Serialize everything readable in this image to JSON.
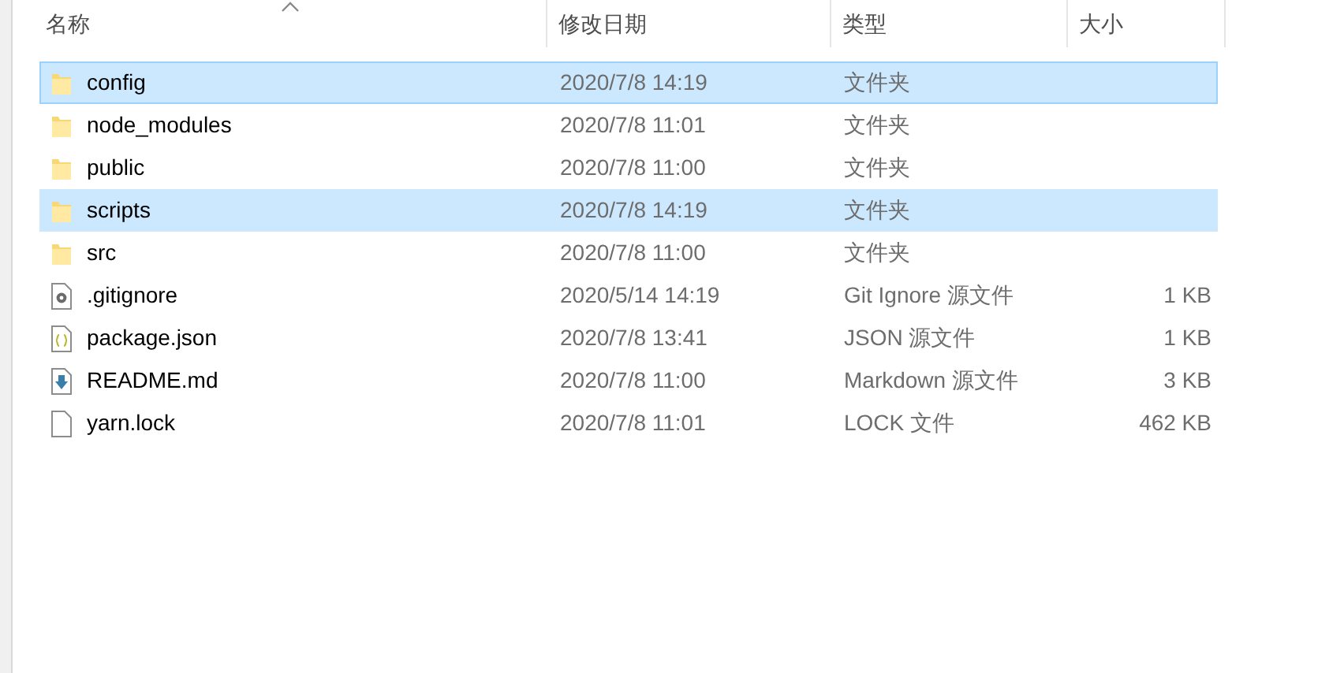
{
  "columns": [
    {
      "label": "名称",
      "sorted": true
    },
    {
      "label": "修改日期",
      "sorted": false
    },
    {
      "label": "类型",
      "sorted": false
    },
    {
      "label": "大小",
      "sorted": false
    }
  ],
  "rows": [
    {
      "name": "config",
      "kind": "folder",
      "date": "2020/7/8 14:19",
      "type": "文件夹",
      "selected": true,
      "focused": true
    },
    {
      "name": "node_modules",
      "kind": "folder",
      "date": "2020/7/8 11:01",
      "type": "文件夹",
      "selected": false,
      "focused": false
    },
    {
      "name": "public",
      "kind": "folder",
      "date": "2020/7/8 11:00",
      "type": "文件夹",
      "selected": false,
      "focused": false
    },
    {
      "name": "scripts",
      "kind": "folder",
      "date": "2020/7/8 14:19",
      "type": "文件夹",
      "selected": true,
      "focused": false
    },
    {
      "name": "src",
      "kind": "folder",
      "date": "2020/7/8 11:00",
      "type": "文件夹",
      "selected": false,
      "focused": false
    },
    {
      "name": ".gitignore",
      "kind": "settings",
      "date": "2020/5/14 14:19",
      "type": "Git Ignore 源文件",
      "size": "1 KB",
      "selected": false,
      "focused": false
    },
    {
      "name": "package.json",
      "kind": "json",
      "date": "2020/7/8 13:41",
      "type": "JSON 源文件",
      "size": "1 KB",
      "selected": false,
      "focused": false
    },
    {
      "name": "README.md",
      "kind": "markdown",
      "date": "2020/7/8 11:00",
      "type": "Markdown 源文件",
      "size": "3 KB",
      "selected": false,
      "focused": false
    },
    {
      "name": "yarn.lock",
      "kind": "file",
      "date": "2020/7/8 11:01",
      "type": "LOCK 文件",
      "size": "462 KB",
      "selected": false,
      "focused": false
    }
  ]
}
